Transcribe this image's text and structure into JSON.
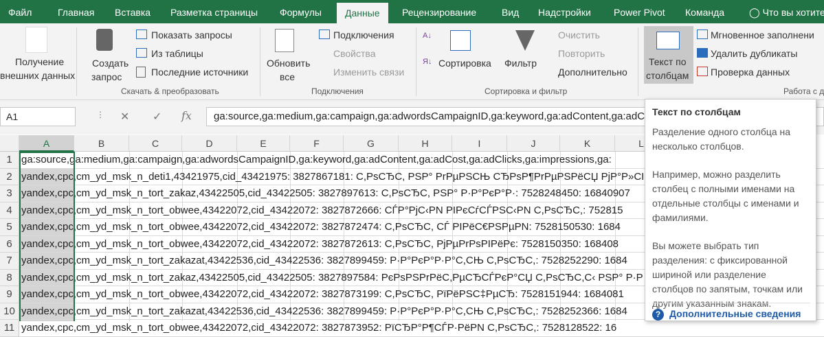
{
  "tabs": [
    "Файл",
    "Главная",
    "Вставка",
    "Разметка страницы",
    "Формулы",
    "Данные",
    "Рецензирование",
    "Вид",
    "Надстройки",
    "Power Pivot",
    "Команда"
  ],
  "tell_me": "Что вы хотите",
  "ribbon": {
    "get_external_1": "Получение",
    "get_external_2": "внешних данных",
    "new_query_1": "Создать",
    "new_query_2": "запрос",
    "show_queries": "Показать запросы",
    "from_table": "Из таблицы",
    "recent_sources": "Последние источники",
    "group_get_transform": "Скачать & преобразовать",
    "refresh_all_1": "Обновить",
    "refresh_all_2": "все",
    "connections": "Подключения",
    "properties": "Свойства",
    "edit_links": "Изменить связи",
    "group_connections": "Подключения",
    "sort": "Сортировка",
    "filter": "Фильтр",
    "clear": "Очистить",
    "reapply": "Повторить",
    "advanced": "Дополнительно",
    "group_sort_filter": "Сортировка и фильтр",
    "text_to_columns_1": "Текст по",
    "text_to_columns_2": "столбцам",
    "flash_fill": "Мгновенное заполнени",
    "remove_duplicates": "Удалить дубликаты",
    "data_validation": "Проверка данных",
    "group_data_tools": "Работа с д"
  },
  "formula_bar": {
    "name_box": "A1",
    "formula": "ga:source,ga:medium,ga:campaign,ga:adwordsCampaignID,ga:keyword,ga:adContent,ga:adCost,ga:adClicks,ga:impressions,ga:"
  },
  "columns": [
    "A",
    "B",
    "C",
    "D",
    "E",
    "F",
    "G",
    "H",
    "I",
    "J",
    "K",
    "L"
  ],
  "rows": [
    {
      "n": "1",
      "text": "ga:source,ga:medium,ga:campaign,ga:adwordsCampaignID,ga:keyword,ga:adContent,ga:adCost,ga:adClicks,ga:impressions,ga:"
    },
    {
      "n": "2",
      "text": "yandex,cpc,cm_yd_msk_n_deti1,43421975,cid_43421975: 3827867181: C,PsCЂC, PSP° PrPµPSCЊ CЂPsP¶PrPµPSPёCЏ PjP°P»CI"
    },
    {
      "n": "3",
      "text": "yandex,cpc,cm_yd_msk_n_tort_zakaz,43422505,cid_43422505: 3827897613: C,PsCЂC, PSP° P·P°PєP°P·: 7528248450: 16840907"
    },
    {
      "n": "4",
      "text": "yandex,cpc,cm_yd_msk_n_tort_obwee,43422072,cid_43422072: 3827872666: CЃP°PjC‹PN PIPєCѓCЃPSC‹PN C,PsCЂC,: 752815"
    },
    {
      "n": "5",
      "text": "yandex,cpc,cm_yd_msk_n_tort_obwee,43422072,cid_43422072: 3827872474: C,PsCЂC, CЃ PIPёC€PSPµPN: 7528150530: 1684"
    },
    {
      "n": "6",
      "text": "yandex,cpc,cm_yd_msk_n_tort_obwee,43422072,cid_43422072: 3827872613: C,PsCЂC, PjPµPrPsPIPёPє: 7528150350: 168408"
    },
    {
      "n": "7",
      "text": "yandex,cpc,cm_yd_msk_n_tort_zakazat,43422536,cid_43422536: 3827899459: P·P°PєP°P·P°C,CЊ C,PsCЂC,: 7528252290: 1684"
    },
    {
      "n": "8",
      "text": "yandex,cpc,cm_yd_msk_n_tort_zakaz,43422505,cid_43422505: 3827897584: PєPsPSPrPёC,PµCЂCЃPєP°CЏ C,PsCЂC,C‹ PSP° P·P"
    },
    {
      "n": "9",
      "text": "yandex,cpc,cm_yd_msk_n_tort_obwee,43422072,cid_43422072: 3827873199: C,PsCЂC, PïPёPSC‡PµCЂ: 7528151944: 1684081"
    },
    {
      "n": "10",
      "text": "yandex,cpc,cm_yd_msk_n_tort_zakazat,43422536,cid_43422536: 3827899459: P·P°PєP°P·P°C,CЊ C,PsCЂC,: 7528252366: 1684"
    },
    {
      "n": "11",
      "text": "yandex,cpc,cm_yd_msk_n_tort_obwee,43422072,cid_43422072: 3827873952: PïCЂP°P¶CЃP·PёPN C,PsCЂC,: 7528128522: 16"
    }
  ],
  "tooltip": {
    "title": "Текст по столбцам",
    "p1": "Разделение одного столбца на несколько столбцов.",
    "p2": "Например, можно разделить столбец с полными именами на отдельные столбцы с именами и фамилиями.",
    "p3": "Вы можете выбрать тип разделения: с фиксированной шириной или разделение столбцов по запятым, точкам или другим указанным знакам.",
    "more": "Дополнительные сведения"
  },
  "colors": {
    "accent": "#217346",
    "link": "#1e5aa8"
  }
}
